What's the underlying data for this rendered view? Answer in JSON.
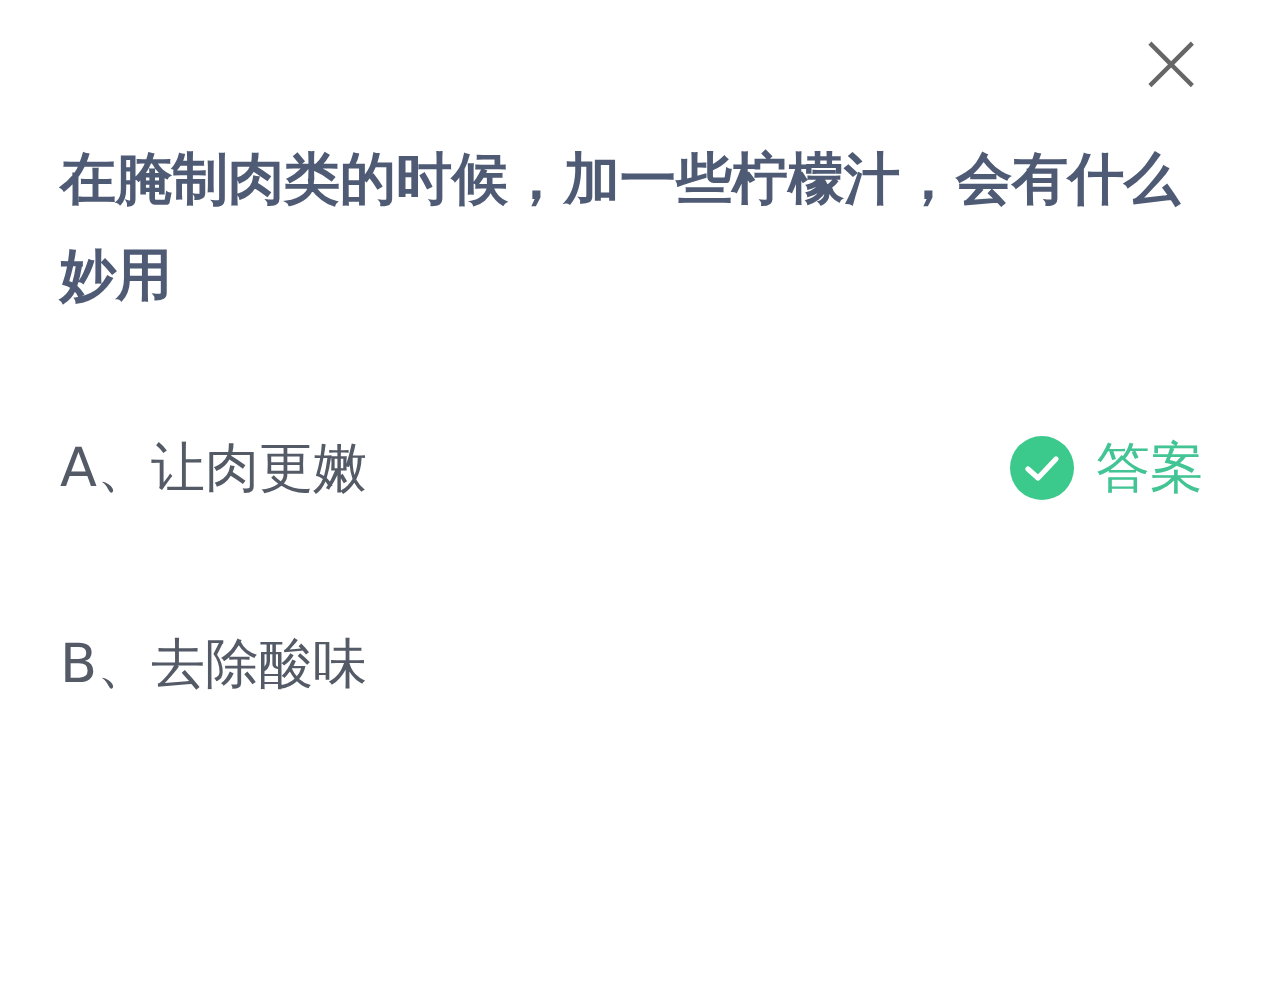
{
  "close_label": "×",
  "question": "在腌制肉类的时候，加一些柠檬汁，会有什么妙用",
  "options": [
    {
      "label": "A、让肉更嫩",
      "correct": true,
      "badge": "答案"
    },
    {
      "label": "B、去除酸味",
      "correct": false
    }
  ]
}
